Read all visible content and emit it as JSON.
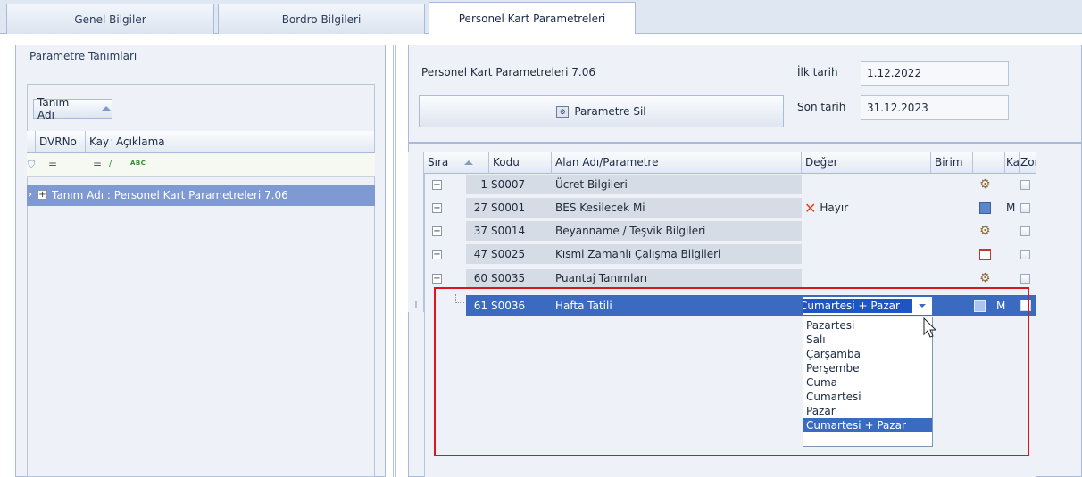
{
  "tabs": [
    {
      "label": "Genel Bilgiler"
    },
    {
      "label": "Bordro Bilgileri"
    },
    {
      "label": "Personel Kart Parametreleri"
    }
  ],
  "left": {
    "group_title": "Parametre Tanımları",
    "group_by_label": "Tanım Adı",
    "columns": [
      "DVRNo",
      "Kay",
      "Açıklama"
    ],
    "filter_ops": [
      "=",
      "="
    ],
    "filter_abc": "ABC",
    "group_row": "Tanım Adı : Personel Kart Parametreleri 7.06"
  },
  "right": {
    "param_name": "Personel Kart Parametreleri 7.06",
    "ilk_tarih_label": "İlk tarih",
    "ilk_tarih": "1.12.2022",
    "son_tarih_label": "Son tarih",
    "son_tarih": "31.12.2023",
    "delete_button": "Parametre Sil"
  },
  "grid": {
    "columns": [
      "Sıra",
      "Kodu",
      "Alan Adı/Parametre",
      "Değer",
      "Birim",
      "",
      "Ka",
      "Zor"
    ],
    "rows": [
      {
        "sira": "1",
        "kodu": "S0007",
        "alan": "Ücret Bilgileri",
        "deger": "",
        "ka": "",
        "expander": "+",
        "icon": "settings-person-icon"
      },
      {
        "sira": "27",
        "kodu": "S0001",
        "alan": "BES Kesilecek Mi",
        "deger": "Hayır",
        "ka": "M",
        "expander": "+",
        "icon": "edit-document-icon"
      },
      {
        "sira": "37",
        "kodu": "S0014",
        "alan": "Beyanname / Teşvik Bilgileri",
        "deger": "",
        "ka": "",
        "expander": "+",
        "icon": "settings-person-icon"
      },
      {
        "sira": "47",
        "kodu": "S0025",
        "alan": "Kısmi Zamanlı Çalışma Bilgileri",
        "deger": "",
        "ka": "",
        "expander": "+",
        "icon": "calendar-settings-icon"
      },
      {
        "sira": "60",
        "kodu": "S0035",
        "alan": "Puantaj Tanımları",
        "deger": "",
        "ka": "",
        "expander": "−",
        "icon": "settings-person-icon"
      }
    ],
    "selected_row": {
      "sira": "61",
      "kodu": "S0036",
      "alan": "Hafta Tatili",
      "deger": "Cumartesi + Pazar",
      "ka": "M"
    }
  },
  "dropdown": {
    "options": [
      "Pazartesi",
      "Salı",
      "Çarşamba",
      "Perşembe",
      "Cuma",
      "Cumartesi",
      "Pazar",
      "Cumartesi + Pazar"
    ],
    "selected": "Cumartesi + Pazar"
  },
  "colors": {
    "selection": "#3a6bc1",
    "highlight_border": "#e0141e",
    "no_icon": "#e0451f"
  }
}
